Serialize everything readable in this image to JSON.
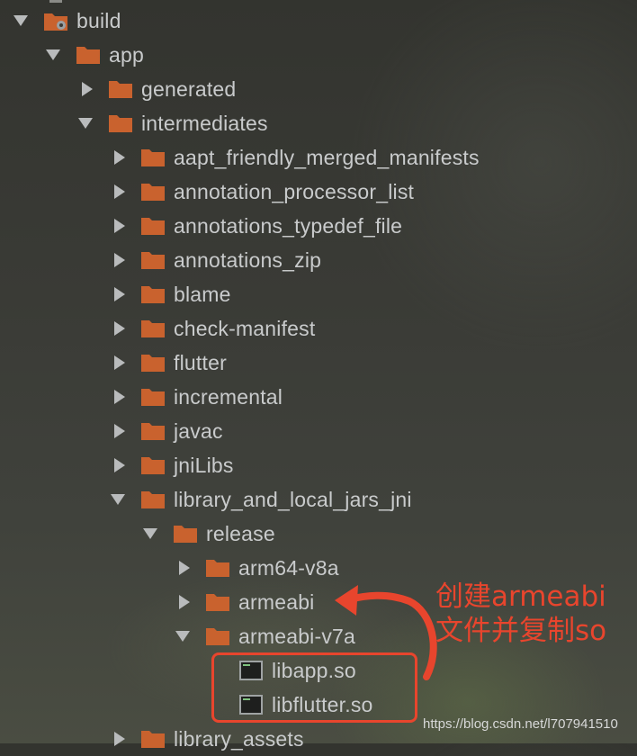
{
  "tree": {
    "rows": [
      {
        "label": "build",
        "arrow": "down",
        "icon": "build-folder"
      },
      {
        "label": "app",
        "arrow": "down",
        "icon": "folder"
      },
      {
        "label": "generated",
        "arrow": "right",
        "icon": "folder"
      },
      {
        "label": "intermediates",
        "arrow": "down",
        "icon": "folder"
      },
      {
        "label": "aapt_friendly_merged_manifests",
        "arrow": "right",
        "icon": "folder"
      },
      {
        "label": "annotation_processor_list",
        "arrow": "right",
        "icon": "folder"
      },
      {
        "label": "annotations_typedef_file",
        "arrow": "right",
        "icon": "folder"
      },
      {
        "label": "annotations_zip",
        "arrow": "right",
        "icon": "folder"
      },
      {
        "label": "blame",
        "arrow": "right",
        "icon": "folder"
      },
      {
        "label": "check-manifest",
        "arrow": "right",
        "icon": "folder"
      },
      {
        "label": "flutter",
        "arrow": "right",
        "icon": "folder"
      },
      {
        "label": "incremental",
        "arrow": "right",
        "icon": "folder"
      },
      {
        "label": "javac",
        "arrow": "right",
        "icon": "folder"
      },
      {
        "label": "jniLibs",
        "arrow": "right",
        "icon": "folder"
      },
      {
        "label": "library_and_local_jars_jni",
        "arrow": "down",
        "icon": "folder"
      },
      {
        "label": "release",
        "arrow": "down",
        "icon": "folder"
      },
      {
        "label": "arm64-v8a",
        "arrow": "right",
        "icon": "folder"
      },
      {
        "label": "armeabi",
        "arrow": "right",
        "icon": "folder"
      },
      {
        "label": "armeabi-v7a",
        "arrow": "down",
        "icon": "folder"
      },
      {
        "label": "libapp.so",
        "arrow": "none",
        "icon": "binary-file"
      },
      {
        "label": "libflutter.so",
        "arrow": "none",
        "icon": "binary-file"
      },
      {
        "label": "library_assets",
        "arrow": "right",
        "icon": "folder"
      }
    ]
  },
  "annotation": {
    "line1": "创建armeabi",
    "line2": "文件并复制so"
  },
  "watermark": "https://blog.csdn.net/l707941510",
  "colors": {
    "folder": "#c9622e",
    "text": "#c9cbcc",
    "annotation": "#e8452d"
  }
}
